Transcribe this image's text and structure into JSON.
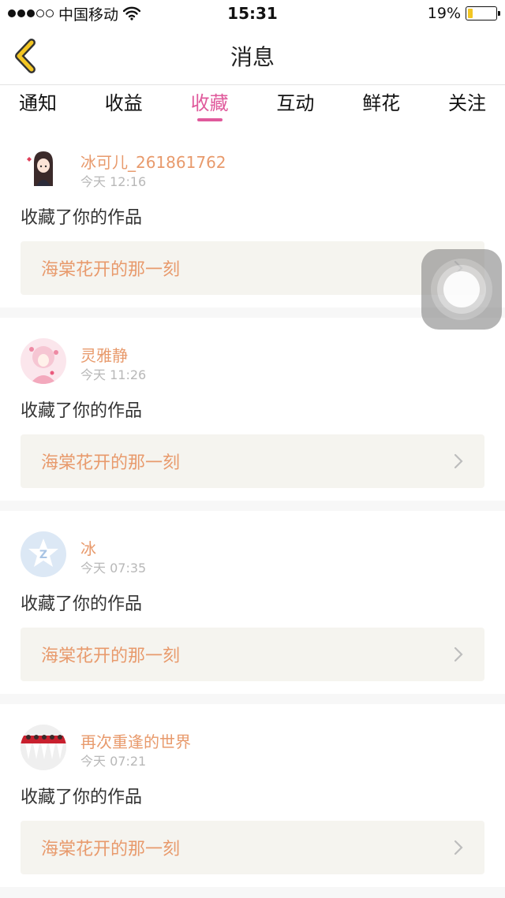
{
  "status_bar": {
    "carrier": "中国移动",
    "time": "15:31",
    "battery_percent": "19%",
    "battery_level": 0.19,
    "signal_bars_filled": 3,
    "signal_bars_total": 5,
    "wifi_icon": "wifi-icon"
  },
  "nav": {
    "title": "消息",
    "back_icon": "chevron-left-icon",
    "accent_color": "#f3c623"
  },
  "tabs": [
    {
      "label": "通知",
      "active": false
    },
    {
      "label": "收益",
      "active": false
    },
    {
      "label": "收藏",
      "active": true
    },
    {
      "label": "互动",
      "active": false
    },
    {
      "label": "鲜花",
      "active": false
    },
    {
      "label": "关注",
      "active": false
    }
  ],
  "colors": {
    "active_tab": "#e05a9c",
    "username": "#e89a6c",
    "work_title": "#e89a6c"
  },
  "messages": [
    {
      "user": "冰可儿_261861762",
      "time": "今天 12:16",
      "action": "收藏了你的作品",
      "work": "海棠花开的那一刻",
      "avatar_icon": "anime-girl-avatar"
    },
    {
      "user": "灵雅静",
      "time": "今天 11:26",
      "action": "收藏了你的作品",
      "work": "海棠花开的那一刻",
      "avatar_icon": "pink-anime-avatar"
    },
    {
      "user": "冰",
      "time": "今天 07:35",
      "action": "收藏了你的作品",
      "work": "海棠花开的那一刻",
      "avatar_icon": "default-qq-avatar"
    },
    {
      "user": "再次重逢的世界",
      "time": "今天 07:21",
      "action": "收藏了你的作品",
      "work": "海棠花开的那一刻",
      "avatar_icon": "dancers-avatar"
    }
  ]
}
